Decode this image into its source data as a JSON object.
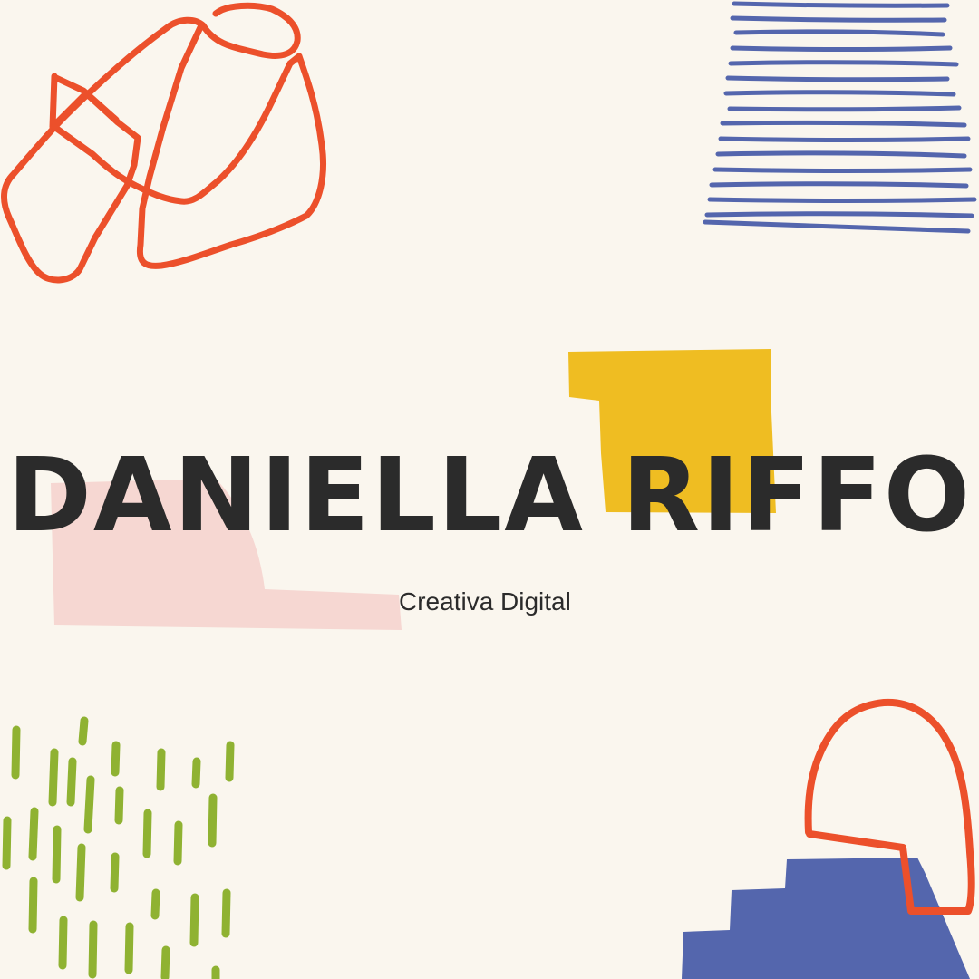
{
  "name": "DANIELLA RIFFO",
  "tagline": "Creativa Digital",
  "colors": {
    "background": "#faf6ee",
    "orange": "#ec502b",
    "blue": "#5466ad",
    "yellow": "#efbd22",
    "pink": "#f6d7d2",
    "green": "#8fb232",
    "text": "#2b2b2b"
  },
  "decorations": [
    "orange-scribble-loop",
    "blue-horizontal-lines",
    "yellow-block",
    "pink-block",
    "green-dash-marks",
    "blue-steps",
    "orange-arch"
  ]
}
